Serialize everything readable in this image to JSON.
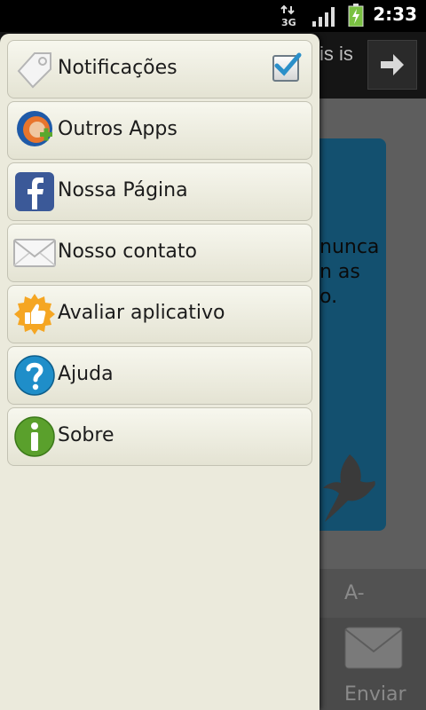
{
  "status_bar": {
    "time": "2:33",
    "network": "3G",
    "icons": [
      "3g-icon",
      "signal-icon",
      "battery-charging-icon"
    ]
  },
  "background": {
    "app_title_fragment": "is is",
    "card_lines": [
      "nunca",
      "n as",
      "o."
    ],
    "font_decrease_label": "A-",
    "send_label": "Enviar"
  },
  "menu": {
    "items": [
      {
        "label": "Notificações",
        "icon": "tag-icon",
        "checked": true
      },
      {
        "label": "Outros Apps",
        "icon": "outros-apps-icon"
      },
      {
        "label": "Nossa Página",
        "icon": "facebook-icon"
      },
      {
        "label": "Nosso contato",
        "icon": "envelope-icon"
      },
      {
        "label": "Avaliar aplicativo",
        "icon": "thumbs-up-icon"
      },
      {
        "label": "Ajuda",
        "icon": "help-icon"
      },
      {
        "label": "Sobre",
        "icon": "info-icon"
      }
    ]
  },
  "colors": {
    "drawer": "#ebeadc",
    "card": "#13506f",
    "check": "#2b8fc9"
  }
}
